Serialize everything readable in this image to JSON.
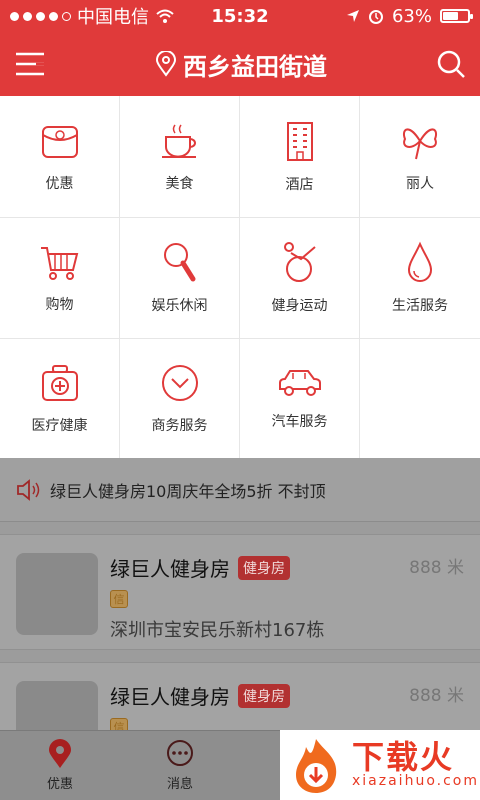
{
  "status_bar": {
    "carrier": "中国电信",
    "time": "15:32",
    "battery": "63%",
    "battery_level": 0.63
  },
  "nav": {
    "title": "西乡益田街道",
    "menu_icon": "menu-icon",
    "location_icon": "location-pin-icon",
    "search_icon": "search-icon"
  },
  "categories": [
    {
      "label": "优惠",
      "icon": "coupon-icon"
    },
    {
      "label": "美食",
      "icon": "coffee-cup-icon"
    },
    {
      "label": "酒店",
      "icon": "hotel-building-icon"
    },
    {
      "label": "丽人",
      "icon": "butterfly-icon"
    },
    {
      "label": "购物",
      "icon": "shopping-cart-icon"
    },
    {
      "label": "娱乐休闲",
      "icon": "drumstick-icon"
    },
    {
      "label": "健身运动",
      "icon": "fitness-ball-icon"
    },
    {
      "label": "生活服务",
      "icon": "water-drop-icon"
    },
    {
      "label": "医疗健康",
      "icon": "medical-kit-icon"
    },
    {
      "label": "商务服务",
      "icon": "chevron-circle-icon"
    },
    {
      "label": "汽车服务",
      "icon": "car-icon"
    }
  ],
  "notice": {
    "text": "绿巨人健身房10周庆年全场5折 不封顶",
    "icon": "speaker-icon"
  },
  "listings": [
    {
      "name": "绿巨人健身房",
      "tag": "健身房",
      "badge": "信",
      "address": "深圳市宝安民乐新村167栋",
      "distance": "888 米"
    },
    {
      "name": "绿巨人健身房",
      "tag": "健身房",
      "badge": "信",
      "address": "",
      "distance": "888 米"
    }
  ],
  "tabs": [
    {
      "label": "优惠",
      "icon": "location-pin-icon"
    },
    {
      "label": "消息",
      "icon": "chat-bubble-icon"
    }
  ],
  "watermark": {
    "main": "下载火",
    "sub": "xiazaihuo.com"
  },
  "colors": {
    "brand": "#e03a3a",
    "overlay": "#9c9c9c"
  }
}
